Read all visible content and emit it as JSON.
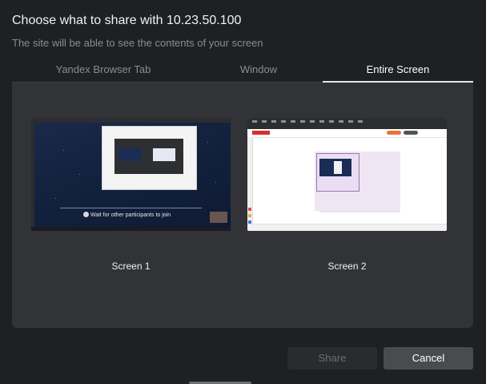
{
  "dialog": {
    "title": "Choose what to share with 10.23.50.100",
    "subtitle": "The site will be able to see the contents of your screen"
  },
  "tabs": [
    {
      "label": "Yandex Browser Tab",
      "active": false
    },
    {
      "label": "Window",
      "active": false
    },
    {
      "label": "Entire Screen",
      "active": true
    }
  ],
  "screens": [
    {
      "label": "Screen 1",
      "preview_text": "Wait for other participants to join"
    },
    {
      "label": "Screen 2"
    }
  ],
  "buttons": {
    "share_label": "Share",
    "cancel_label": "Cancel"
  },
  "colors": {
    "background": "#1f2023",
    "panel": "#323336",
    "active_tab_text": "#ffffff",
    "inactive_tab_text": "#8c8c8f",
    "cancel_button": "#4a4b4f",
    "share_button_disabled": "#2a2b2e"
  }
}
